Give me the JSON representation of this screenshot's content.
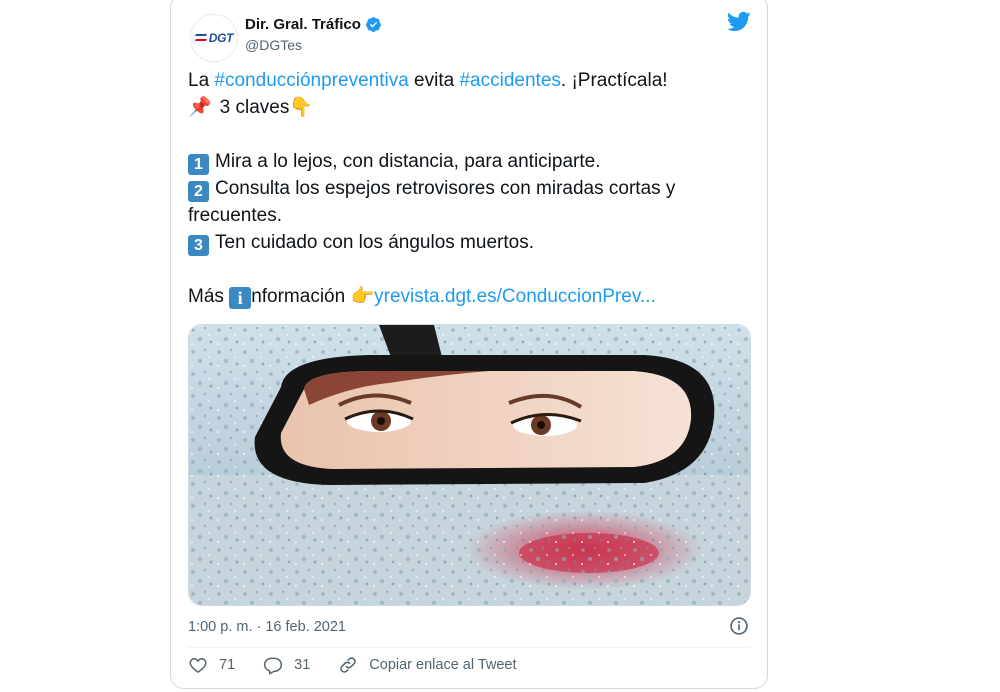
{
  "tweet": {
    "author_name": "Dir. Gral. Tráfico",
    "author_handle": "@DGTes",
    "logo_text": "DGT",
    "text": {
      "line1_a": "La ",
      "hashtag1": "#conducciónpreventiva",
      "line1_b": " evita ",
      "hashtag2": "#accidentes",
      "line1_c": ". ¡Practícala!",
      "claves": "3 claves",
      "item1_num": "1",
      "item1": "Mira a lo lejos, con distancia, para anticiparte.",
      "item2_num": "2",
      "item2_a": "Consulta los espejos retrovisores con miradas cortas y",
      "item2_b": "frecuentes.",
      "item3_num": "3",
      "item3": "Ten cuidado con los ángulos muertos.",
      "mas": "Más ",
      "info_letter": "i",
      "informacion": "nformación ",
      "url": "yrevista.dgt.es/ConduccionPrev..."
    },
    "timestamp": "1:00 p. m. · 16 feb. 2021",
    "likes": "71",
    "replies": "31",
    "copy_link": "Copiar enlace al Tweet"
  },
  "icons": {
    "verified": "verified-badge-icon",
    "bird": "twitter-bird-icon",
    "pin": "pushpin-icon",
    "down_hand": "backhand-index-pointing-down-icon",
    "right_hand": "backhand-index-pointing-right-icon",
    "info": "info-icon",
    "like": "heart-icon",
    "reply": "reply-bubble-icon",
    "link": "link-icon"
  },
  "colors": {
    "link": "#1d9bf0",
    "verified": "#1d9bf0",
    "keycap": "#3b88c3",
    "secondary_text": "#536471",
    "brand_blue": "#1d4f9c"
  }
}
